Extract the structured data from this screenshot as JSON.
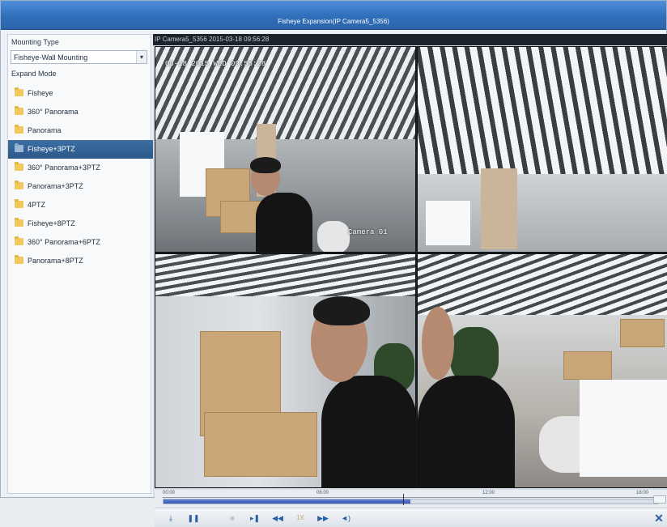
{
  "window": {
    "title": "Fisheye Expansion(IP Camera5_5356)"
  },
  "sidebar": {
    "mounting_type_label": "Mounting Type",
    "mounting_type_value": "Fisheye-Wall Mounting",
    "expand_mode_label": "Expand Mode",
    "modes": [
      {
        "label": "Fisheye",
        "active": false
      },
      {
        "label": "360° Panorama",
        "active": false
      },
      {
        "label": "Panorama",
        "active": false
      },
      {
        "label": "Fisheye+3PTZ",
        "active": true
      },
      {
        "label": "360° Panorama+3PTZ",
        "active": false
      },
      {
        "label": "Panorama+3PTZ",
        "active": false
      },
      {
        "label": "4PTZ",
        "active": false
      },
      {
        "label": "Fisheye+8PTZ",
        "active": false
      },
      {
        "label": "360° Panorama+6PTZ",
        "active": false
      },
      {
        "label": "Panorama+8PTZ",
        "active": false
      }
    ]
  },
  "video": {
    "header_text": "IP Camera5_5356   2015-03-18 09:56:28",
    "osd_top": "03-18  2015  WED 09:56:28",
    "osd_camera": "Camera 01"
  },
  "timeline": {
    "tick_labels": [
      "00:00",
      "06:00",
      "12:00",
      "18:00"
    ],
    "progress_fraction": 0.5
  },
  "controls": {
    "download_icon": "download-icon",
    "pause_icon": "pause-icon",
    "stop_icon": "stop-icon",
    "step_forward_icon": "step-forward-icon",
    "slow_icon": "slow-icon",
    "speed_label": "1X",
    "fast_icon": "fast-icon",
    "volume_icon": "volume-icon",
    "close_icon": "close-icon"
  },
  "colors": {
    "titlebar": "#2f6fba",
    "active_item": "#2c5889",
    "accent": "#2a5ea4"
  }
}
